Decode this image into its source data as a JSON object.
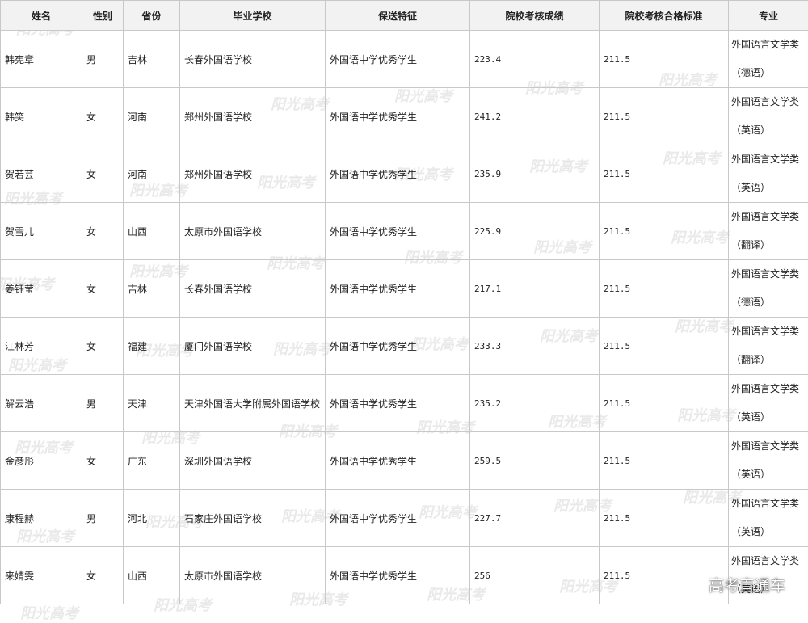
{
  "table": {
    "headers": [
      "姓名",
      "性别",
      "省份",
      "毕业学校",
      "保送特征",
      "院校考核成绩",
      "院校考核合格标准",
      "专业"
    ],
    "rows": [
      {
        "name": "韩宪章",
        "gender": "男",
        "province": "吉林",
        "school": "长春外国语学校",
        "feature": "外国语中学优秀学生",
        "score": "223.4",
        "standard": "211.5",
        "major_line1": "外国语言文学类",
        "major_line2": "（德语）"
      },
      {
        "name": "韩笑",
        "gender": "女",
        "province": "河南",
        "school": "郑州外国语学校",
        "feature": "外国语中学优秀学生",
        "score": "241.2",
        "standard": "211.5",
        "major_line1": "外国语言文学类",
        "major_line2": "（英语）"
      },
      {
        "name": "贺若芸",
        "gender": "女",
        "province": "河南",
        "school": "郑州外国语学校",
        "feature": "外国语中学优秀学生",
        "score": "235.9",
        "standard": "211.5",
        "major_line1": "外国语言文学类",
        "major_line2": "（英语）"
      },
      {
        "name": "贺雪儿",
        "gender": "女",
        "province": "山西",
        "school": "太原市外国语学校",
        "feature": "外国语中学优秀学生",
        "score": "225.9",
        "standard": "211.5",
        "major_line1": "外国语言文学类",
        "major_line2": "（翻译）"
      },
      {
        "name": "姜钰莹",
        "gender": "女",
        "province": "吉林",
        "school": "长春外国语学校",
        "feature": "外国语中学优秀学生",
        "score": "217.1",
        "standard": "211.5",
        "major_line1": "外国语言文学类",
        "major_line2": "（德语）"
      },
      {
        "name": "江林芳",
        "gender": "女",
        "province": "福建",
        "school": "厦门外国语学校",
        "feature": "外国语中学优秀学生",
        "score": "233.3",
        "standard": "211.5",
        "major_line1": "外国语言文学类",
        "major_line2": "（翻译）"
      },
      {
        "name": "解云浩",
        "gender": "男",
        "province": "天津",
        "school": "天津外国语大学附属外国语学校",
        "feature": "外国语中学优秀学生",
        "score": "235.2",
        "standard": "211.5",
        "major_line1": "外国语言文学类",
        "major_line2": "（英语）"
      },
      {
        "name": "金彦彤",
        "gender": "女",
        "province": "广东",
        "school": "深圳外国语学校",
        "feature": "外国语中学优秀学生",
        "score": "259.5",
        "standard": "211.5",
        "major_line1": "外国语言文学类",
        "major_line2": "（英语）"
      },
      {
        "name": "康程赫",
        "gender": "男",
        "province": "河北",
        "school": "石家庄外国语学校",
        "feature": "外国语中学优秀学生",
        "score": "227.7",
        "standard": "211.5",
        "major_line1": "外国语言文学类",
        "major_line2": "（英语）"
      },
      {
        "name": "来婧雯",
        "gender": "女",
        "province": "山西",
        "school": "太原市外国语学校",
        "feature": "外国语中学优秀学生",
        "score": "256",
        "standard": "211.5",
        "major_line1": "外国语言文学类",
        "major_line2": "（英语）"
      }
    ]
  },
  "watermark": {
    "text": "阳光高考"
  },
  "brand": {
    "text": "高考直通车"
  }
}
